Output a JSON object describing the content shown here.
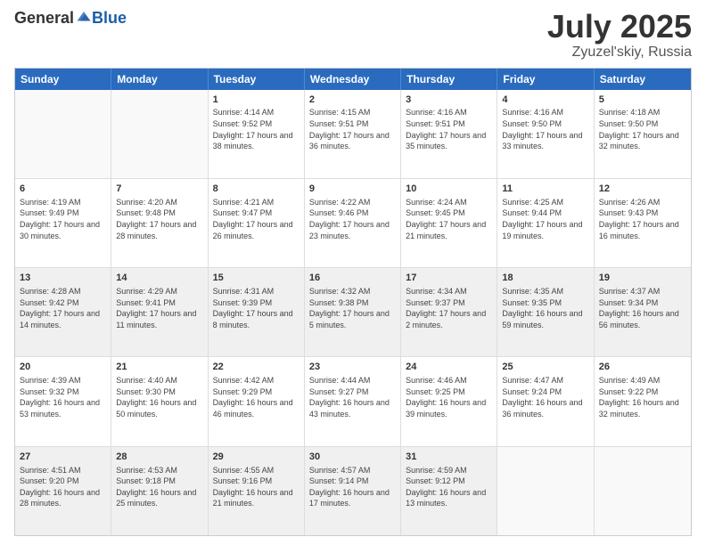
{
  "logo": {
    "general": "General",
    "blue": "Blue"
  },
  "title": "July 2025",
  "location": "Zyuzel'skiy, Russia",
  "days": [
    "Sunday",
    "Monday",
    "Tuesday",
    "Wednesday",
    "Thursday",
    "Friday",
    "Saturday"
  ],
  "weeks": [
    [
      {
        "day": "",
        "info": "",
        "empty": true
      },
      {
        "day": "",
        "info": "",
        "empty": true
      },
      {
        "day": "1",
        "info": "Sunrise: 4:14 AM\nSunset: 9:52 PM\nDaylight: 17 hours and 38 minutes."
      },
      {
        "day": "2",
        "info": "Sunrise: 4:15 AM\nSunset: 9:51 PM\nDaylight: 17 hours and 36 minutes."
      },
      {
        "day": "3",
        "info": "Sunrise: 4:16 AM\nSunset: 9:51 PM\nDaylight: 17 hours and 35 minutes."
      },
      {
        "day": "4",
        "info": "Sunrise: 4:16 AM\nSunset: 9:50 PM\nDaylight: 17 hours and 33 minutes."
      },
      {
        "day": "5",
        "info": "Sunrise: 4:18 AM\nSunset: 9:50 PM\nDaylight: 17 hours and 32 minutes."
      }
    ],
    [
      {
        "day": "6",
        "info": "Sunrise: 4:19 AM\nSunset: 9:49 PM\nDaylight: 17 hours and 30 minutes."
      },
      {
        "day": "7",
        "info": "Sunrise: 4:20 AM\nSunset: 9:48 PM\nDaylight: 17 hours and 28 minutes."
      },
      {
        "day": "8",
        "info": "Sunrise: 4:21 AM\nSunset: 9:47 PM\nDaylight: 17 hours and 26 minutes."
      },
      {
        "day": "9",
        "info": "Sunrise: 4:22 AM\nSunset: 9:46 PM\nDaylight: 17 hours and 23 minutes."
      },
      {
        "day": "10",
        "info": "Sunrise: 4:24 AM\nSunset: 9:45 PM\nDaylight: 17 hours and 21 minutes."
      },
      {
        "day": "11",
        "info": "Sunrise: 4:25 AM\nSunset: 9:44 PM\nDaylight: 17 hours and 19 minutes."
      },
      {
        "day": "12",
        "info": "Sunrise: 4:26 AM\nSunset: 9:43 PM\nDaylight: 17 hours and 16 minutes."
      }
    ],
    [
      {
        "day": "13",
        "info": "Sunrise: 4:28 AM\nSunset: 9:42 PM\nDaylight: 17 hours and 14 minutes.",
        "shaded": true
      },
      {
        "day": "14",
        "info": "Sunrise: 4:29 AM\nSunset: 9:41 PM\nDaylight: 17 hours and 11 minutes.",
        "shaded": true
      },
      {
        "day": "15",
        "info": "Sunrise: 4:31 AM\nSunset: 9:39 PM\nDaylight: 17 hours and 8 minutes.",
        "shaded": true
      },
      {
        "day": "16",
        "info": "Sunrise: 4:32 AM\nSunset: 9:38 PM\nDaylight: 17 hours and 5 minutes.",
        "shaded": true
      },
      {
        "day": "17",
        "info": "Sunrise: 4:34 AM\nSunset: 9:37 PM\nDaylight: 17 hours and 2 minutes.",
        "shaded": true
      },
      {
        "day": "18",
        "info": "Sunrise: 4:35 AM\nSunset: 9:35 PM\nDaylight: 16 hours and 59 minutes.",
        "shaded": true
      },
      {
        "day": "19",
        "info": "Sunrise: 4:37 AM\nSunset: 9:34 PM\nDaylight: 16 hours and 56 minutes.",
        "shaded": true
      }
    ],
    [
      {
        "day": "20",
        "info": "Sunrise: 4:39 AM\nSunset: 9:32 PM\nDaylight: 16 hours and 53 minutes."
      },
      {
        "day": "21",
        "info": "Sunrise: 4:40 AM\nSunset: 9:30 PM\nDaylight: 16 hours and 50 minutes."
      },
      {
        "day": "22",
        "info": "Sunrise: 4:42 AM\nSunset: 9:29 PM\nDaylight: 16 hours and 46 minutes."
      },
      {
        "day": "23",
        "info": "Sunrise: 4:44 AM\nSunset: 9:27 PM\nDaylight: 16 hours and 43 minutes."
      },
      {
        "day": "24",
        "info": "Sunrise: 4:46 AM\nSunset: 9:25 PM\nDaylight: 16 hours and 39 minutes."
      },
      {
        "day": "25",
        "info": "Sunrise: 4:47 AM\nSunset: 9:24 PM\nDaylight: 16 hours and 36 minutes."
      },
      {
        "day": "26",
        "info": "Sunrise: 4:49 AM\nSunset: 9:22 PM\nDaylight: 16 hours and 32 minutes."
      }
    ],
    [
      {
        "day": "27",
        "info": "Sunrise: 4:51 AM\nSunset: 9:20 PM\nDaylight: 16 hours and 28 minutes.",
        "shaded": true
      },
      {
        "day": "28",
        "info": "Sunrise: 4:53 AM\nSunset: 9:18 PM\nDaylight: 16 hours and 25 minutes.",
        "shaded": true
      },
      {
        "day": "29",
        "info": "Sunrise: 4:55 AM\nSunset: 9:16 PM\nDaylight: 16 hours and 21 minutes.",
        "shaded": true
      },
      {
        "day": "30",
        "info": "Sunrise: 4:57 AM\nSunset: 9:14 PM\nDaylight: 16 hours and 17 minutes.",
        "shaded": true
      },
      {
        "day": "31",
        "info": "Sunrise: 4:59 AM\nSunset: 9:12 PM\nDaylight: 16 hours and 13 minutes.",
        "shaded": true
      },
      {
        "day": "",
        "info": "",
        "empty": true,
        "shaded": true
      },
      {
        "day": "",
        "info": "",
        "empty": true,
        "shaded": true
      }
    ]
  ]
}
